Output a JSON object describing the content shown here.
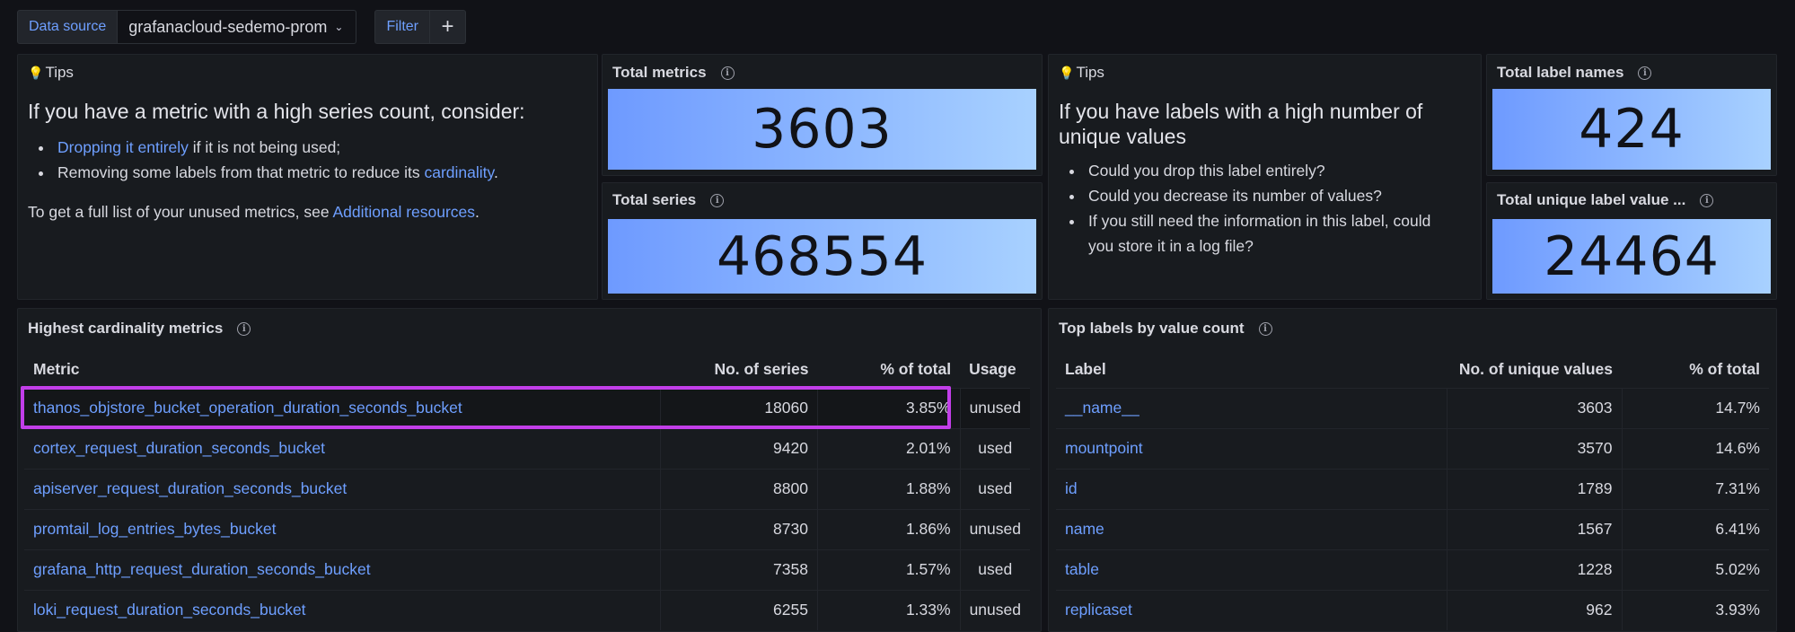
{
  "toolbar": {
    "datasource_label": "Data source",
    "datasource_value": "grafanacloud-sedemo-prom",
    "filter_label": "Filter",
    "add_label": "+"
  },
  "tips_metrics": {
    "title": "Tips",
    "heading": "If you have a metric with a high series count, consider:",
    "item1_link": "Dropping it entirely",
    "item1_rest": " if it is not being used;",
    "item2_text": "Removing some labels from that metric to reduce its ",
    "item2_link": "cardinality",
    "item2_end": ".",
    "foot_text": "To get a full list of your unused metrics, see ",
    "foot_link": "Additional resources",
    "foot_end": "."
  },
  "stats": {
    "total_metrics_title": "Total metrics",
    "total_metrics_value": "3603",
    "total_series_title": "Total series",
    "total_series_value": "468554",
    "total_label_names_title": "Total label names",
    "total_label_names_value": "424",
    "total_unique_label_values_title": "Total unique label value ...",
    "total_unique_label_values_value": "24464"
  },
  "tips_labels": {
    "title": "Tips",
    "heading_line1": "If you have labels with a high number of",
    "heading_line2": "unique values",
    "item1": "Could you drop this label entirely?",
    "item2": "Could you decrease its number of values?",
    "item3_line1": "If you still need the information in this label, could",
    "item3_line2": "you store it in a log file?"
  },
  "metrics_table": {
    "title": "Highest cardinality metrics",
    "columns": [
      "Metric",
      "No. of series",
      "% of total",
      "Usage"
    ],
    "rows": [
      {
        "metric": "thanos_objstore_bucket_operation_duration_seconds_bucket",
        "series": "18060",
        "pct": "3.85%",
        "usage": "unused"
      },
      {
        "metric": "cortex_request_duration_seconds_bucket",
        "series": "9420",
        "pct": "2.01%",
        "usage": "used"
      },
      {
        "metric": "apiserver_request_duration_seconds_bucket",
        "series": "8800",
        "pct": "1.88%",
        "usage": "used"
      },
      {
        "metric": "promtail_log_entries_bytes_bucket",
        "series": "8730",
        "pct": "1.86%",
        "usage": "unused"
      },
      {
        "metric": "grafana_http_request_duration_seconds_bucket",
        "series": "7358",
        "pct": "1.57%",
        "usage": "used"
      },
      {
        "metric": "loki_request_duration_seconds_bucket",
        "series": "6255",
        "pct": "1.33%",
        "usage": "unused"
      }
    ]
  },
  "labels_table": {
    "title": "Top labels by value count",
    "columns": [
      "Label",
      "No. of unique values",
      "% of total"
    ],
    "rows": [
      {
        "label": "__name__",
        "count": "3603",
        "pct": "14.7%"
      },
      {
        "label": "mountpoint",
        "count": "3570",
        "pct": "14.6%"
      },
      {
        "label": "id",
        "count": "1789",
        "pct": "7.31%"
      },
      {
        "label": "name",
        "count": "1567",
        "pct": "6.41%"
      },
      {
        "label": "table",
        "count": "1228",
        "pct": "5.02%"
      },
      {
        "label": "replicaset",
        "count": "962",
        "pct": "3.93%"
      }
    ]
  },
  "colors": {
    "background": "#111217",
    "panel": "#181b1f",
    "link": "#6e9fff",
    "stat_gradient_start": "#6e9aff",
    "stat_gradient_end": "#a8d1ff",
    "highlight_border": "#c23ee9"
  },
  "icons": [
    "chevron-down-icon",
    "plus-icon",
    "lightbulb-icon",
    "info-icon"
  ]
}
